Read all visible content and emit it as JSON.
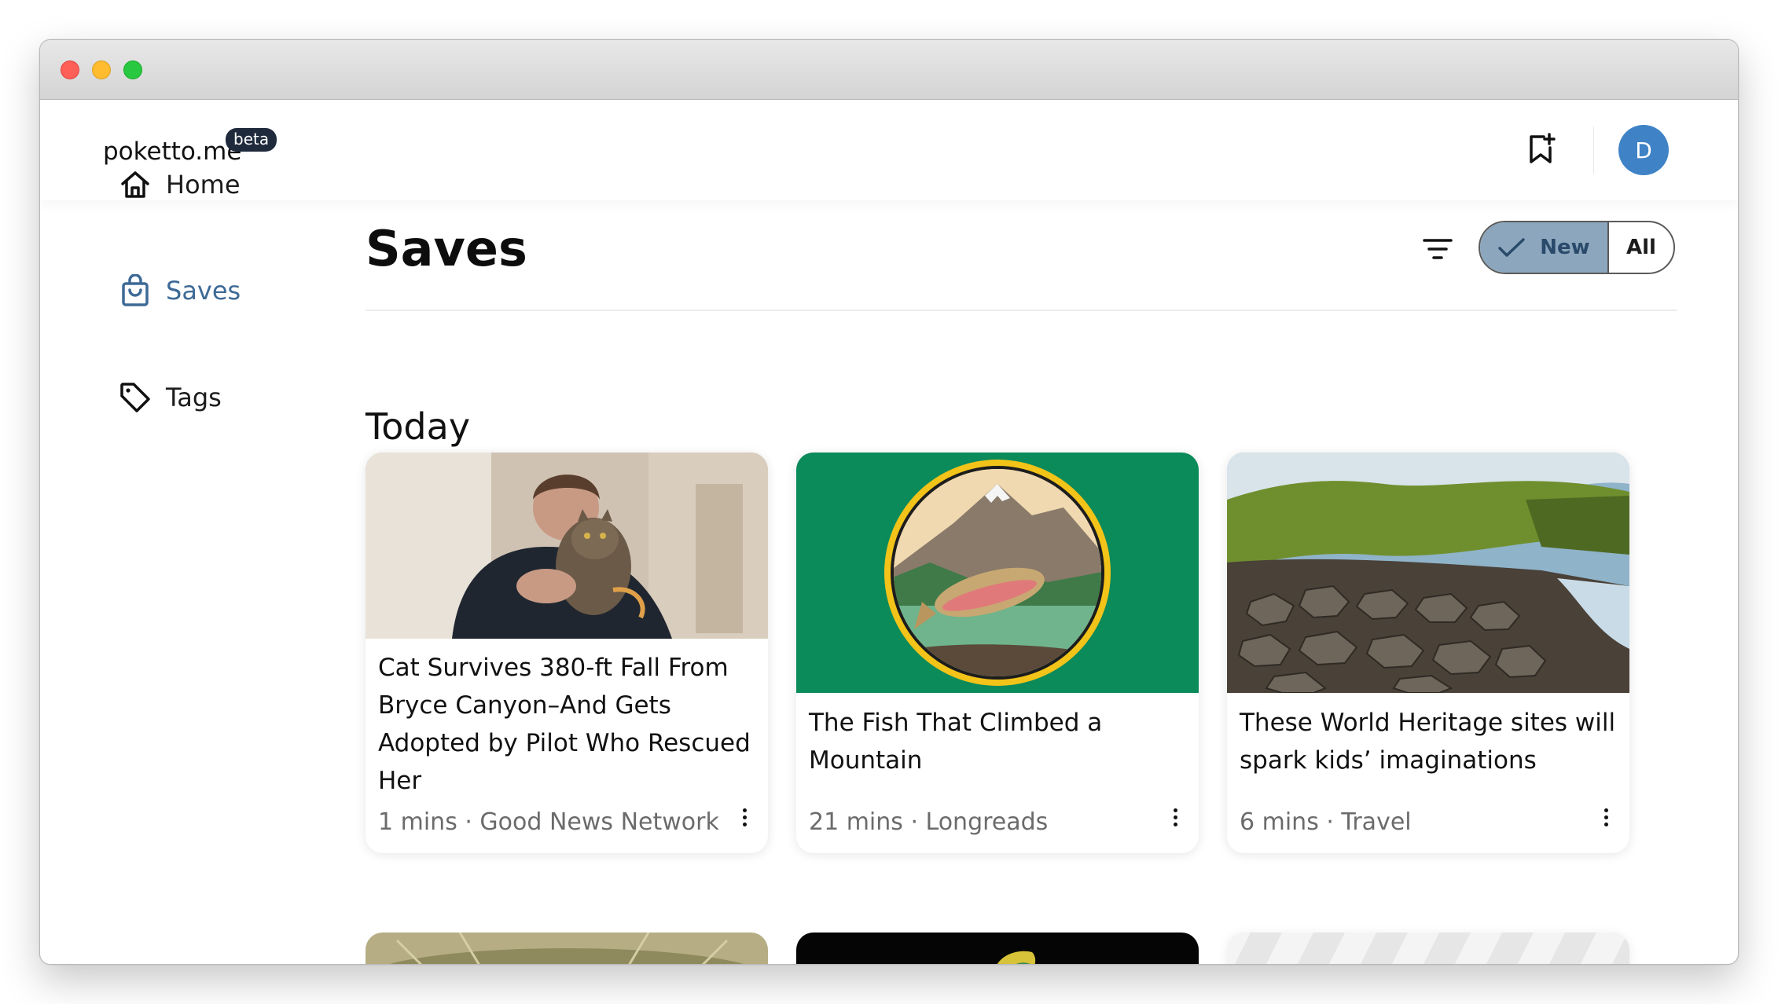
{
  "app": {
    "logo": "poketto.me",
    "badge": "beta",
    "avatar_initial": "D"
  },
  "sidebar": {
    "items": [
      {
        "label": "Home",
        "icon": "home-icon"
      },
      {
        "label": "Saves",
        "icon": "shopping-bag-icon",
        "active": true
      },
      {
        "label": "Tags",
        "icon": "tag-icon"
      }
    ]
  },
  "main": {
    "title": "Saves",
    "toggle": {
      "new_label": "New",
      "all_label": "All",
      "selected": "New"
    },
    "section_title": "Today",
    "cards": [
      {
        "title": "Cat Survives 380-ft Fall From Bryce Canyon–And Gets Adopted by Pilot Who Rescued Her",
        "meta": "1 mins · Good News Network"
      },
      {
        "title": "The Fish That Climbed a Mountain",
        "meta": "21 mins · Longreads"
      },
      {
        "title": "These World Heritage sites will spark kids’ imaginations",
        "meta": "6 mins · Travel"
      }
    ]
  },
  "colors": {
    "accent": "#3d6a96",
    "toggle_selected": "#8ca7bd",
    "avatar": "#3f83c6",
    "fish_card_bg": "#0b8a5a"
  }
}
